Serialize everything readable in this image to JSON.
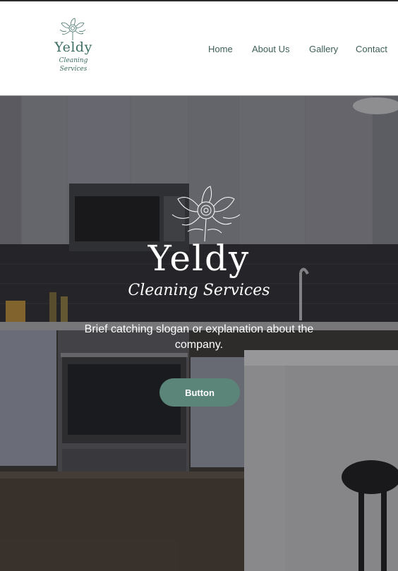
{
  "brand": {
    "name": "Yeldy",
    "tagline": "Cleaning Services"
  },
  "nav": {
    "items": [
      "Home",
      "About Us",
      "Gallery",
      "Contact"
    ]
  },
  "hero": {
    "title": "Yeldy",
    "subtitle": "Cleaning Services",
    "slogan": "Brief catching slogan or explanation about the company.",
    "button_label": "Button"
  },
  "colors": {
    "accent": "#5b8579",
    "brand_text": "#3d6e63",
    "nav_text": "#3d5f58"
  }
}
